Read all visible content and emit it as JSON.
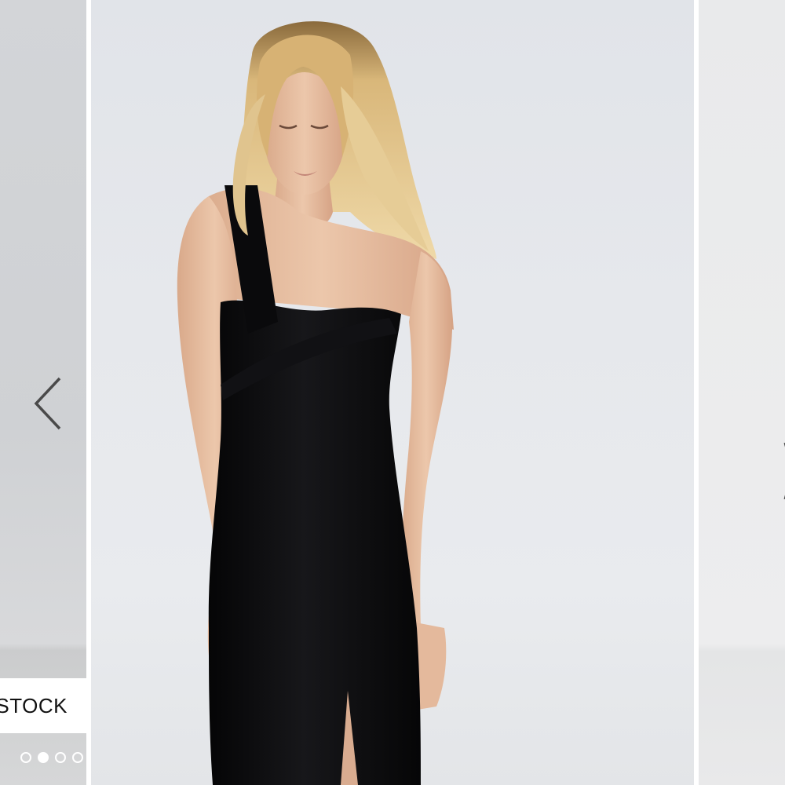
{
  "gallery": {
    "stock_label": "STOCK",
    "prev_icon": "chevron-left-icon",
    "next_icon": "chevron-right-icon",
    "main_image_alt": "",
    "dots": [
      {
        "active": false
      },
      {
        "active": true
      },
      {
        "active": false
      },
      {
        "active": false
      }
    ]
  },
  "colors": {
    "arrow": "#4a4a4a",
    "dot": "#ffffff",
    "dress": "#0d0d0f",
    "skin": "#e8c0a4",
    "hair": "#e2c48c"
  }
}
